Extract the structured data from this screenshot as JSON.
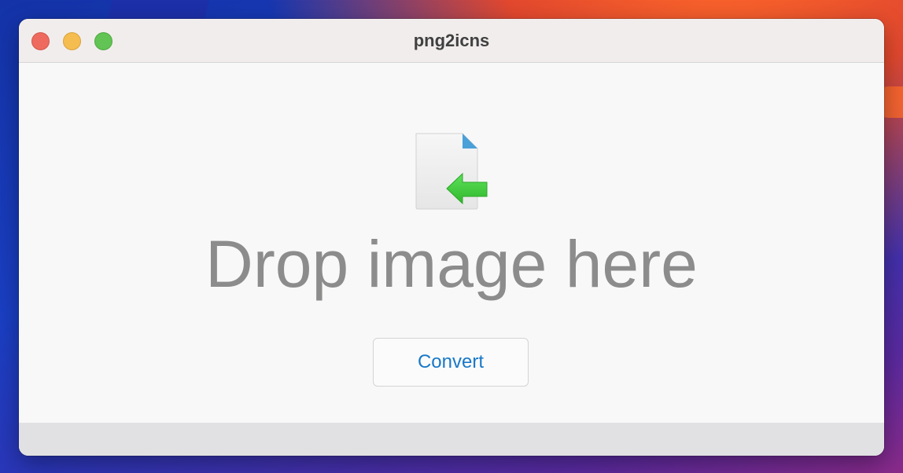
{
  "window": {
    "title": "png2icns"
  },
  "drop_zone": {
    "icon": "document-import-icon",
    "prompt": "Drop image here"
  },
  "actions": {
    "convert_label": "Convert"
  },
  "colors": {
    "accent": "#1978c8",
    "close": "#ee6a5f",
    "minimize": "#f5bd4f",
    "zoom": "#61c454",
    "arrow_green": "#3ec93a"
  }
}
